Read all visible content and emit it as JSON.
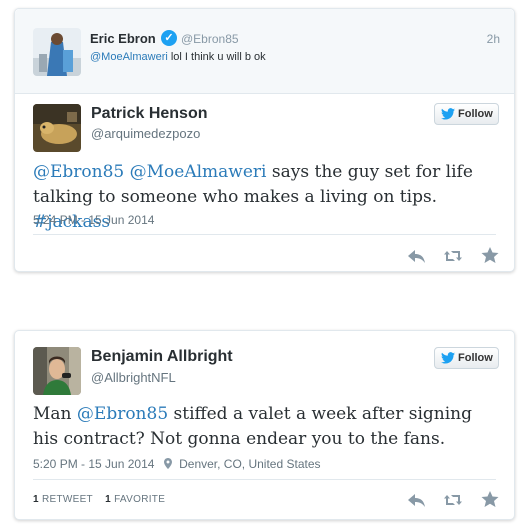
{
  "context_tweet": {
    "name": "Eric Ebron",
    "handle": "@Ebron85",
    "time": "2h",
    "mention": "@MoeAlmaweri",
    "text": " lol I think u will b ok",
    "verified_mark": "✓"
  },
  "tweet1": {
    "name": "Patrick Henson",
    "handle": "@arquimedezpozo",
    "follow_label": "Follow",
    "text_parts": [
      "@Ebron85",
      " ",
      "@MoeAlmaweri",
      " says the guy set for life talking to someone who makes a living on tips. ",
      "#jackass"
    ],
    "timestamp": "5:24 PM - 15 Jun 2014"
  },
  "tweet2": {
    "name": "Benjamin Allbright",
    "handle": "@AllbrightNFL",
    "follow_label": "Follow",
    "text_parts": [
      "Man ",
      "@Ebron85",
      " stiffed a valet a week after signing his contract? Not gonna endear you to the fans."
    ],
    "timestamp": "5:20 PM - 15 Jun 2014",
    "location": "Denver, CO, United States",
    "retweet_count": "1",
    "retweet_label": "RETWEET",
    "favorite_count": "1",
    "favorite_label": "FAVORITE"
  },
  "icons": {
    "verified": "verified-badge-icon",
    "follow": "twitter-bird-icon",
    "reply": "reply-icon",
    "retweet": "retweet-icon",
    "favorite": "star-icon",
    "location": "location-pin-icon"
  },
  "colors": {
    "link": "#2b7bb9",
    "verified": "#1da1f2",
    "muted": "#66757f",
    "action": "#8899a6"
  }
}
